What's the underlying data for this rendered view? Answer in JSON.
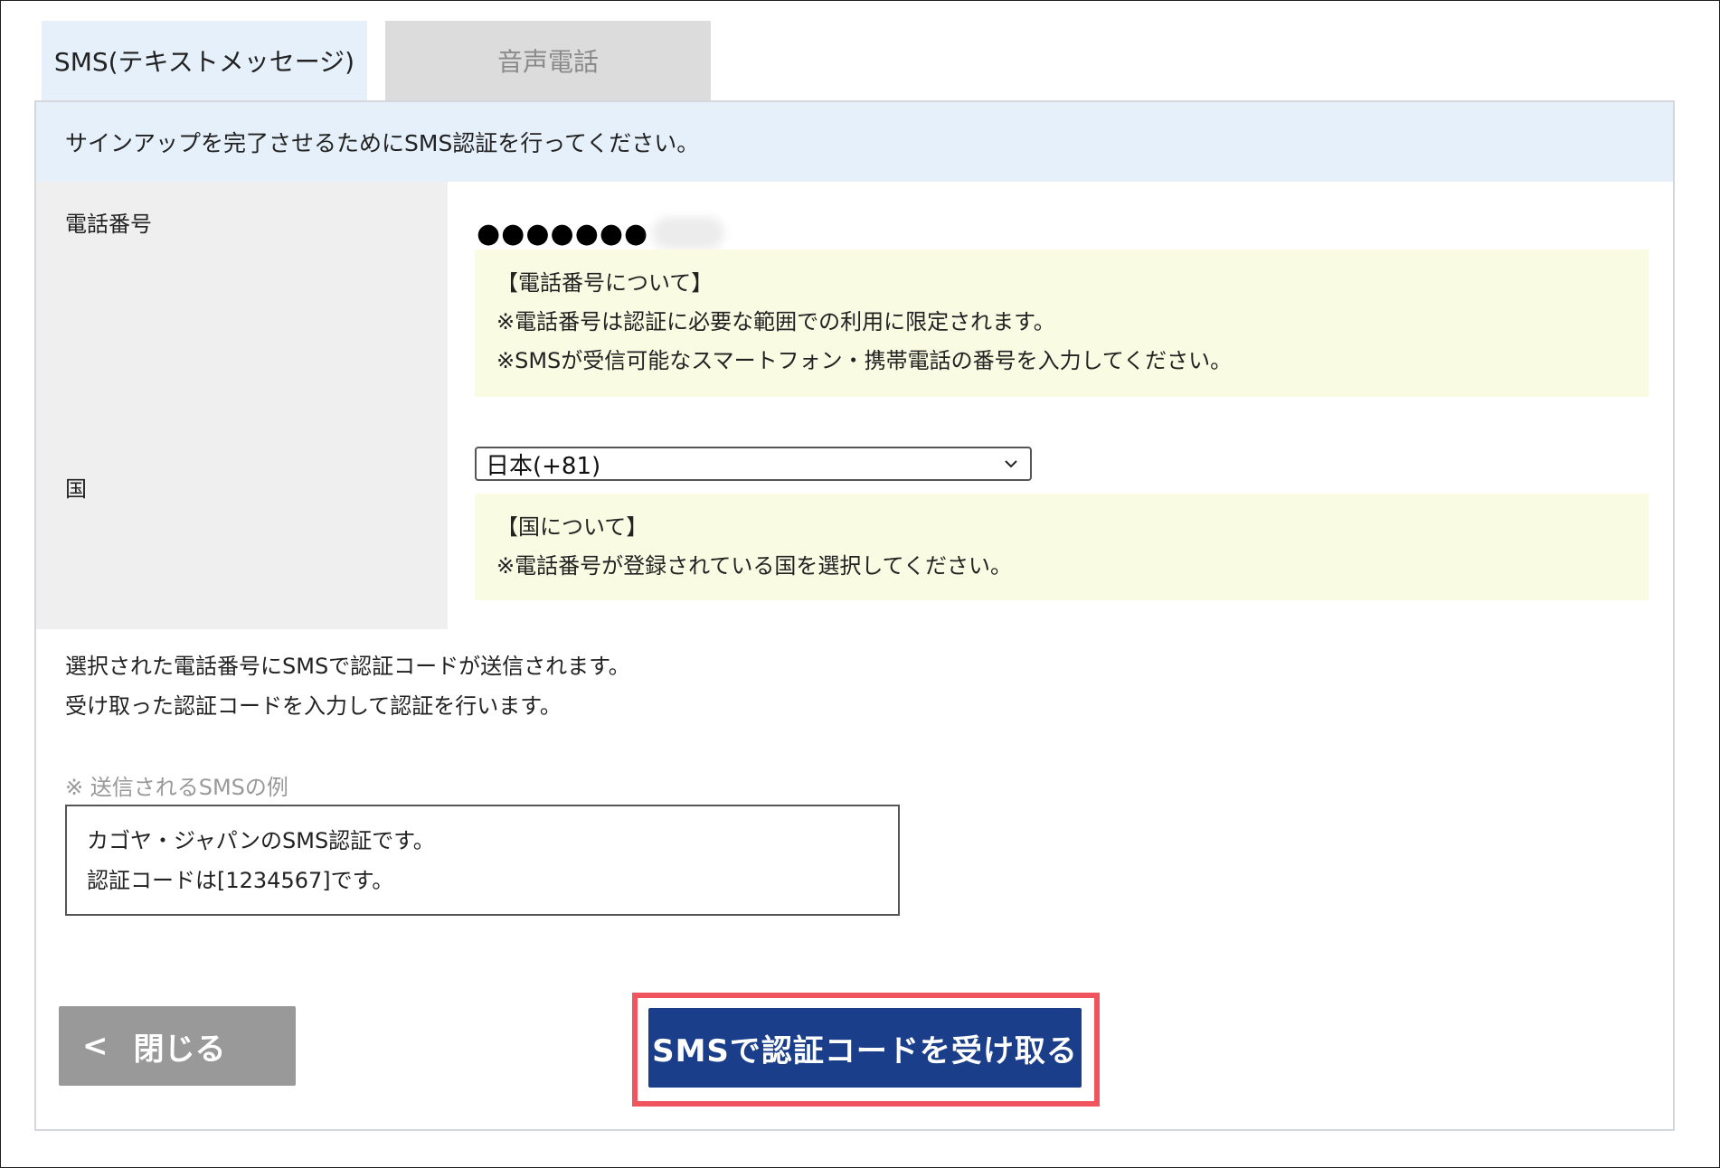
{
  "tabs": [
    {
      "label": "SMS(テキストメッセージ)",
      "active": true
    },
    {
      "label": "音声電話",
      "active": false
    }
  ],
  "intro": "サインアップを完了させるためにSMS認証を行ってください。",
  "phone": {
    "label": "電話番号",
    "masked_value": "●●●●●●●",
    "note_title": "【電話番号について】",
    "note_lines": [
      "※電話番号は認証に必要な範囲での利用に限定されます。",
      "※SMSが受信可能なスマートフォン・携帯電話の番号を入力してください。"
    ]
  },
  "country": {
    "label": "国",
    "selected": "日本(+81)",
    "note_title": "【国について】",
    "note_lines": [
      "※電話番号が登録されている国を選択してください。"
    ]
  },
  "description": [
    "選択された電話番号にSMSで認証コードが送信されます。",
    "受け取った認証コードを入力して認証を行います。"
  ],
  "example": {
    "caption": "※ 送信されるSMSの例",
    "lines": [
      "カゴヤ・ジャパンのSMS認証です。",
      "認証コードは[1234567]です。"
    ]
  },
  "buttons": {
    "close_arrow": "<",
    "close_label": "閉じる",
    "submit_label": "SMSで認証コードを受け取る"
  },
  "colors": {
    "primary": "#1a3e8a",
    "highlight": "#f0545e",
    "tab_active": "#e5f0fa",
    "tab_inactive": "#dcdcdc",
    "note_bg": "#f9fbe3",
    "label_bg": "#efefef"
  }
}
